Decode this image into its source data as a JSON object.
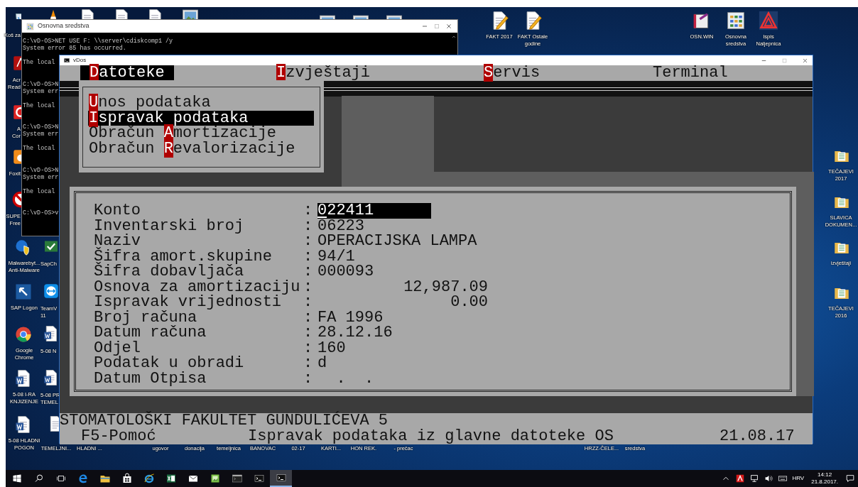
{
  "desktop": {
    "top_row": [
      {
        "kind": "cone"
      },
      {
        "kind": "doc"
      },
      {
        "kind": "doc"
      },
      {
        "kind": "doc"
      },
      {
        "kind": "picture"
      },
      {
        "kind": "picture"
      },
      {
        "kind": "picture"
      },
      {
        "kind": "picture"
      }
    ],
    "left_column": [
      {
        "kind": "recycle",
        "label": "Koš za"
      },
      {
        "kind": "acrobat",
        "label": "Acr\nRead"
      },
      {
        "kind": "pdfapp",
        "label": "A\nCor"
      },
      {
        "kind": "foxit",
        "label": "Foxit"
      },
      {
        "kind": "antivirus",
        "label": "SUPE\nFree"
      },
      {
        "kind": "shield",
        "label": "Malwarebyt...\nAnti-Malware"
      },
      {
        "kind": "sap",
        "label": "SAP Logon"
      },
      {
        "kind": "chrome",
        "label": "Google\nChrome"
      },
      {
        "kind": "word",
        "label": "5-08 I-RA\nKNJIZENJE"
      },
      {
        "kind": "word",
        "label": "5-08 HLADNI\nPOGON"
      }
    ],
    "second_column": [
      {
        "kind": "sapcheck",
        "label": "SapCh"
      },
      {
        "kind": "remote",
        "label": "TeamV\n11"
      },
      {
        "kind": "word",
        "label": "5-08 N"
      },
      {
        "kind": "word",
        "label": "5-08 PR\nTEMEL"
      }
    ],
    "bottom_row": [
      {
        "kind": "doc",
        "label": "TEMELJNI..."
      },
      {
        "label": "HLADNI ..."
      },
      {
        "label": "ugovor"
      },
      {
        "label": "donacija"
      },
      {
        "label": "temeljnica"
      },
      {
        "label": "BANOVAC"
      },
      {
        "label": "02-17"
      },
      {
        "label": "KARTI..."
      },
      {
        "label": "HON REK."
      },
      {
        "label": "- prečac"
      },
      {
        "label": "HRZZ-ČELE..."
      },
      {
        "label": "sredstva"
      }
    ],
    "top_right": [
      {
        "kind": "notepad",
        "label": "FAKT 2017"
      },
      {
        "kind": "notepad",
        "label": "FAKT Ostale\ngodine"
      },
      {
        "kind": "book",
        "label": "OSN.WIN"
      },
      {
        "kind": "grid",
        "label": "Osnovna\nsredstva"
      },
      {
        "kind": "logo",
        "label": "Ispis\nNaljepnica"
      }
    ],
    "right_column": [
      {
        "kind": "folder",
        "label": "TEČAJEVI\n2017"
      },
      {
        "kind": "folder",
        "label": "SLAVICA\nDOKUMEN..."
      },
      {
        "kind": "folder",
        "label": "izvještaji"
      },
      {
        "kind": "folder",
        "label": "TEČAJEVI\n2016"
      }
    ]
  },
  "cmd_window": {
    "title": "Osnovna sredstva",
    "blocks": [
      {
        "command": "C:\\vD-OS>NET USE F: \\\\server\\cdiskcomp1 /y",
        "error": "System error 85 has occurred.",
        "message": "The local"
      },
      {
        "command": "C:\\vD-OS>N",
        "error": "System err",
        "message": "The local"
      },
      {
        "command": "C:\\vD-OS>N",
        "error": "System err",
        "message": "The local"
      },
      {
        "command": "C:\\vD-OS>N",
        "error": "System err",
        "message": "The local"
      }
    ],
    "prompt": "C:\\vD-OS>v"
  },
  "vdos_window": {
    "title": "vDos",
    "menu": [
      {
        "hotkey": "D",
        "rest": "atoteke",
        "selected": true
      },
      {
        "hotkey": "I",
        "rest": "zvještaji",
        "selected": false
      },
      {
        "hotkey": "S",
        "rest": "ervis",
        "selected": false
      },
      {
        "rest": "Terminal",
        "selected": false
      }
    ],
    "dropdown": [
      {
        "hotkey": "U",
        "after": "nos podataka",
        "selected": false
      },
      {
        "hotkey": "I",
        "after": "spravak podataka",
        "selected": true
      },
      {
        "before": "Obračun ",
        "hotkey": "A",
        "after": "mortizacije",
        "selected": false
      },
      {
        "before": "Obračun ",
        "hotkey": "R",
        "after": "evalorizacije",
        "selected": false
      }
    ],
    "form": [
      {
        "label": "Konto",
        "separator": ":",
        "kind": "field",
        "value": "022411"
      },
      {
        "label": "Inventarski broj",
        "separator": ":",
        "kind": "text",
        "value": "06223"
      },
      {
        "label": "Naziv",
        "separator": ":",
        "kind": "text",
        "value": "OPERACIJSKA LAMPA"
      },
      {
        "label": "Šifra amort.skupine",
        "separator": ":",
        "kind": "text",
        "value": "94/1"
      },
      {
        "label": "Šifra dobavljača",
        "separator": ":",
        "kind": "text",
        "value": "000093"
      },
      {
        "label": "Osnova za amortizaciju",
        "separator": ":",
        "kind": "number",
        "value": "12,987.09"
      },
      {
        "label": "Ispravak vrijednosti",
        "separator": ":",
        "kind": "number",
        "value": "0.00"
      },
      {
        "label": "Broj računa",
        "separator": ":",
        "kind": "text",
        "value": "FA 1996"
      },
      {
        "label": "Datum računa",
        "separator": ":",
        "kind": "text",
        "value": "28.12.16"
      },
      {
        "label": "Odjel",
        "separator": ":",
        "kind": "text",
        "value": "160"
      },
      {
        "label": "Podatak u obradi",
        "separator": ":",
        "kind": "text",
        "value": "d"
      },
      {
        "label": "Datum Otpisa",
        "separator": ":",
        "kind": "text",
        "value": "  .  ."
      }
    ],
    "footer": {
      "institution": "STOMATOLOŠKI FAKULTET GUNDULIĆEVA 5",
      "help": "F5-Pomoć",
      "message": "Ispravak podataka iz glavne datoteke OS",
      "date": "21.08.17"
    }
  },
  "taskbar": {
    "apps": [
      {
        "kind": "start"
      },
      {
        "kind": "search"
      },
      {
        "kind": "taskview"
      },
      {
        "kind": "edge",
        "active": false
      },
      {
        "kind": "explorer",
        "active": false
      },
      {
        "kind": "store",
        "active": false
      },
      {
        "kind": "ie",
        "active": false
      },
      {
        "kind": "excel",
        "active": false
      },
      {
        "kind": "mail",
        "active": false
      },
      {
        "kind": "image",
        "active": false
      },
      {
        "kind": "console",
        "active": false
      },
      {
        "kind": "cmd",
        "active": false
      },
      {
        "kind": "cmd",
        "active": true
      }
    ],
    "tray": {
      "language": "HRV",
      "time": "14:12",
      "date": "21.8.2017."
    }
  }
}
